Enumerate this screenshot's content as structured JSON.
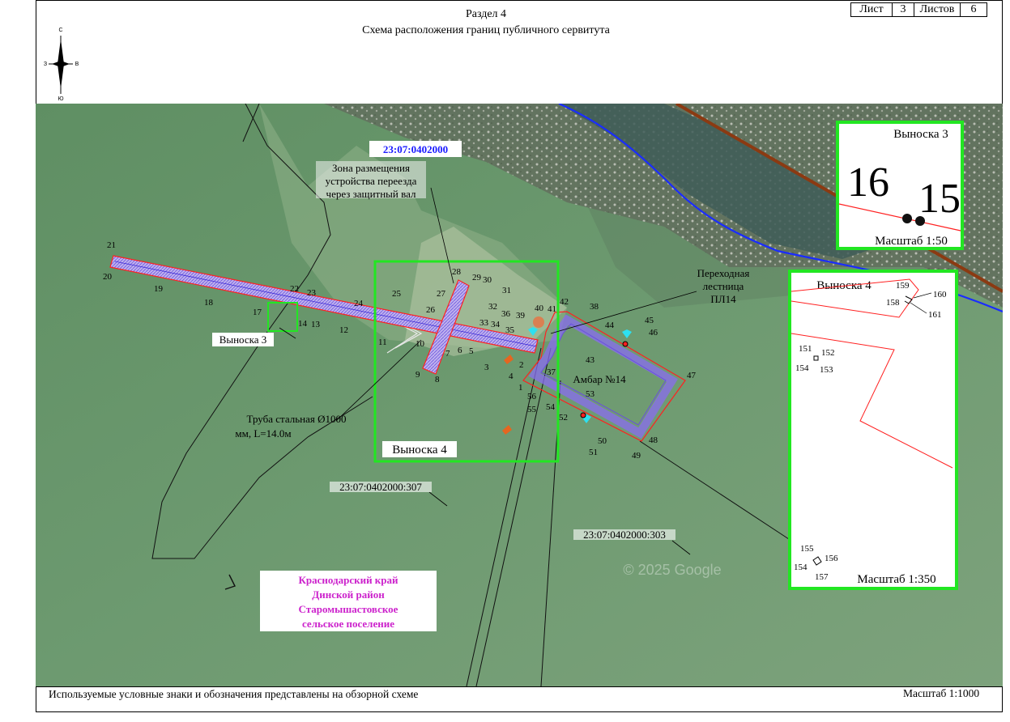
{
  "header": {
    "section": "Раздел 4",
    "title": "Схема расположения границ публичного сервитута",
    "sheet_label": "Лист",
    "sheet_num": "3",
    "sheets_label": "Листов",
    "sheets_total": "6"
  },
  "compass": {
    "n": "С",
    "s": "Ю",
    "w": "З",
    "e": "В"
  },
  "map": {
    "cadastral_block": "23:07:0402000",
    "parcel_307": "23:07:0402000:307",
    "parcel_303": "23:07:0402000:303",
    "zone_note": [
      "Зона размещения",
      "устройства переезда",
      "через защитный вал"
    ],
    "stair_note": [
      "Переходная",
      "лестница",
      "ПЛ14"
    ],
    "pipe_note": [
      "Труба стальная Ø1000",
      "мм, L=14.0м"
    ],
    "barn": "Амбар №14",
    "callout3_label": "Выноска 3",
    "callout4_label": "Выноска 4",
    "region": [
      "Краснодарский край",
      "Динской район",
      "Старомышастовское",
      "сельское поселение"
    ],
    "watermark": "© 2025 Google",
    "colors": {
      "callout": "#22e622",
      "boundary": "#ff2020",
      "corridor": "#8a6cf0",
      "river": "#1a2cff",
      "pipeline": "#8b3a12",
      "region_text": "#cc22cc",
      "block_text": "#1a1aff"
    }
  },
  "inset3": {
    "title": "Выноска 3",
    "left_num": "16",
    "right_num": "15",
    "scale": "Масштаб 1:50"
  },
  "inset4": {
    "title": "Выноска 4",
    "scale": "Масштаб 1:350",
    "labels": [
      "159",
      "160",
      "158",
      "161",
      "151",
      "152",
      "154",
      "153",
      "155",
      "156",
      "154",
      "157"
    ]
  },
  "points": [
    "1",
    "2",
    "3",
    "4",
    "5",
    "6",
    "7",
    "8",
    "9",
    "10",
    "11",
    "12",
    "13",
    "14",
    "17",
    "18",
    "19",
    "20",
    "21",
    "22",
    "23",
    "24",
    "25",
    "26",
    "27",
    "28",
    "29",
    "30",
    "31",
    "32",
    "33",
    "34",
    "35",
    "36",
    "37",
    "38",
    "39",
    "40",
    "41",
    "42",
    "43",
    "44",
    "45",
    "46",
    "47",
    "48",
    "49",
    "50",
    "51",
    "52",
    "53",
    "54",
    "55",
    "56"
  ],
  "footer": {
    "note": "Используемые условные знаки и обозначения представлены на обзорной схеме",
    "scale": "Масштаб 1:1000"
  }
}
